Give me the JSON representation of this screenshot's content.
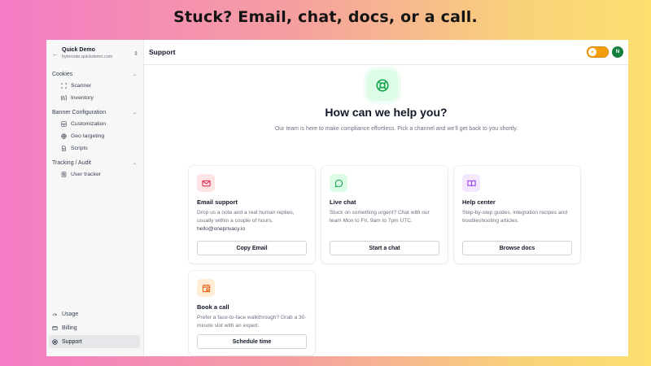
{
  "banner": "Stuck? Email, chat, docs, or a call.",
  "sidebar": {
    "org_name": "Quick Demo",
    "org_domain": "bytecode.quickdemo.com",
    "groups": [
      {
        "label": "Cookies",
        "items": [
          {
            "label": "Scanner",
            "icon": "scan-icon"
          },
          {
            "label": "Inventory",
            "icon": "inventory-icon"
          }
        ]
      },
      {
        "label": "Banner Configuration",
        "items": [
          {
            "label": "Customization",
            "icon": "customization-icon"
          },
          {
            "label": "Geo targeting",
            "icon": "globe-icon"
          },
          {
            "label": "Scripts",
            "icon": "file-icon"
          }
        ]
      },
      {
        "label": "Tracking / Audit",
        "items": [
          {
            "label": "User tracker",
            "icon": "user-icon"
          }
        ]
      }
    ],
    "bottom": [
      {
        "label": "Usage",
        "icon": "gauge-icon"
      },
      {
        "label": "Billing",
        "icon": "billing-icon"
      },
      {
        "label": "Support",
        "icon": "support-icon",
        "active": true
      }
    ]
  },
  "topbar": {
    "title": "Support",
    "avatar_initial": "N"
  },
  "hero": {
    "heading": "How can we help you?",
    "subtitle": "Our team is here to make compliance effortless. Pick a channel and we'll get back to you shortly."
  },
  "cards": [
    {
      "title": "Email support",
      "description": "Drop us a note and a real human replies, usually within a couple of hours.",
      "extra": "hello@oneprivacy.io",
      "button": "Copy Email",
      "icon": "mail-icon",
      "accent": "#e11d48",
      "tint": "#ffe4e6"
    },
    {
      "title": "Live chat",
      "description": "Stuck on something urgent? Chat with our team Mon to Fri, 9am to 7pm UTC.",
      "button": "Start a chat",
      "icon": "chat-icon",
      "accent": "#16a34a",
      "tint": "#dcfce7"
    },
    {
      "title": "Help center",
      "description": "Step-by-step guides, integration recipes and troubleshooting articles.",
      "button": "Browse docs",
      "icon": "book-icon",
      "accent": "#9333ea",
      "tint": "#f3e8ff"
    },
    {
      "title": "Book a call",
      "description": "Prefer a face-to-face walkthrough? Grab a 30-minute slot with an expert.",
      "button": "Schedule time",
      "icon": "calendar-icon",
      "accent": "#ea580c",
      "tint": "#ffedd5"
    }
  ]
}
